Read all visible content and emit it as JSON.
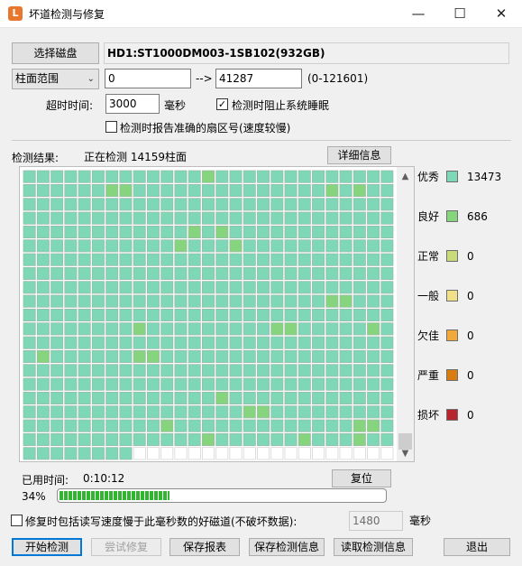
{
  "window": {
    "title": "坏道检测与修复",
    "icon_glyph": "L",
    "minimize_glyph": "—",
    "maximize_glyph": "☐",
    "close_glyph": "✕"
  },
  "disk": {
    "select_button": "选择磁盘",
    "name": "HD1:ST1000DM003-1SB102(932GB)"
  },
  "range": {
    "mode": "柱面范围",
    "chevron": "⌄",
    "start": "0",
    "arrow": "-->",
    "end": "41287",
    "hint": "(0-121601)"
  },
  "timeout": {
    "label": "超时时间:",
    "value": "3000",
    "unit": "毫秒"
  },
  "options": {
    "prevent_sleep_label": "检测时阻止系统睡眠",
    "prevent_sleep_checked": true,
    "report_sector_label": "检测时报告准确的扇区号(速度较慢)",
    "report_sector_checked": false,
    "check_mark": "✓"
  },
  "result": {
    "label": "检测结果:",
    "status": "正在检测 14159柱面",
    "details_button": "详细信息"
  },
  "legend": [
    {
      "name": "优秀",
      "color": "#7ed7b6",
      "count": "13473"
    },
    {
      "name": "良好",
      "color": "#86d47e",
      "count": "686"
    },
    {
      "name": "正常",
      "color": "#c8da7c",
      "count": "0"
    },
    {
      "name": "一般",
      "color": "#f0e08a",
      "count": "0"
    },
    {
      "name": "欠佳",
      "color": "#f2a93b",
      "count": "0"
    },
    {
      "name": "严重",
      "color": "#d97d12",
      "count": "0"
    },
    {
      "name": "损坏",
      "color": "#b8262d",
      "count": "0"
    }
  ],
  "grid": {
    "columns": 27,
    "rows": 21,
    "blocks_shown": 548,
    "good_positions": [
      [
        0,
        13
      ],
      [
        1,
        6
      ],
      [
        1,
        7
      ],
      [
        1,
        22
      ],
      [
        1,
        24
      ],
      [
        4,
        12
      ],
      [
        4,
        14
      ],
      [
        5,
        11
      ],
      [
        5,
        15
      ],
      [
        9,
        22
      ],
      [
        9,
        23
      ],
      [
        11,
        8
      ],
      [
        11,
        18
      ],
      [
        11,
        19
      ],
      [
        11,
        25
      ],
      [
        13,
        1
      ],
      [
        13,
        8
      ],
      [
        13,
        9
      ],
      [
        16,
        14
      ],
      [
        17,
        16
      ],
      [
        17,
        17
      ],
      [
        18,
        10
      ],
      [
        18,
        24
      ],
      [
        18,
        25
      ],
      [
        19,
        13
      ],
      [
        19,
        20
      ],
      [
        19,
        24
      ]
    ]
  },
  "elapsed": {
    "label": "已用时间:",
    "value": "0:10:12",
    "reset_button": "复位"
  },
  "progress": {
    "percent_text": "34%",
    "fraction": 0.34
  },
  "repair_option": {
    "label": "修复时包括读写速度慢于此毫秒数的好磁道(不破坏数据):",
    "checked": false,
    "value": "1480",
    "unit": "毫秒"
  },
  "scroll": {
    "up_arrow": "▲",
    "down_arrow": "▼"
  },
  "footer": {
    "start": "开始检测",
    "try_repair": "尝试修复",
    "save_report": "保存报表",
    "save_info": "保存检测信息",
    "load_info": "读取检测信息",
    "exit": "退出"
  },
  "colors": {
    "excellent": "#7ed7b6",
    "good": "#86d47e",
    "unchecked": "#ffffff",
    "progress": "#31b531"
  }
}
